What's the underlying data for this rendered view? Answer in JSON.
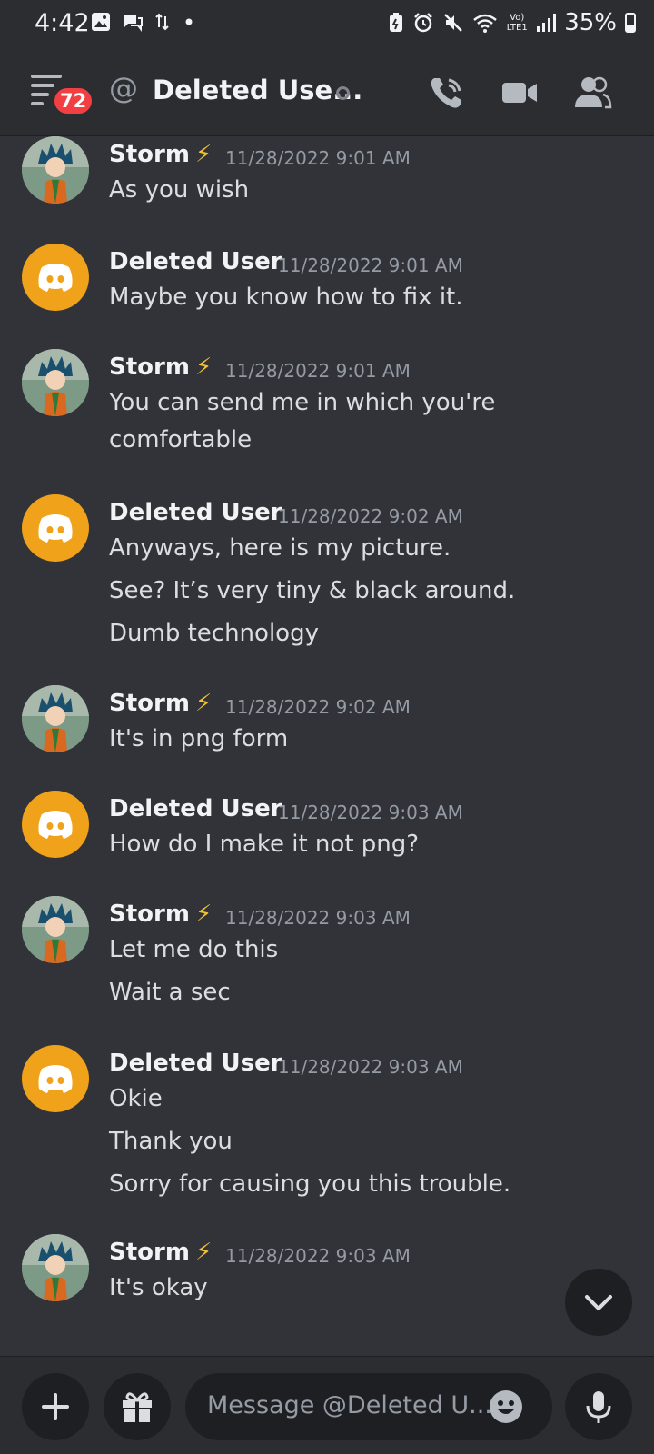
{
  "status_bar": {
    "time": "4:42",
    "battery": "35%",
    "network_label": "Vo) LTE1"
  },
  "header": {
    "notification_count": "72",
    "title": "Deleted Use..."
  },
  "messages": [
    {
      "author": "Storm",
      "bolt": "⚡",
      "timestamp": "11/28/2022 9:01 AM",
      "avatar": "storm",
      "lines": [
        "As you wish"
      ]
    },
    {
      "author": "Deleted User",
      "bolt": "",
      "timestamp": "11/28/2022 9:01 AM",
      "avatar": "discord",
      "lines": [
        "Maybe you know how to fix it."
      ]
    },
    {
      "author": "Storm",
      "bolt": "⚡",
      "timestamp": "11/28/2022 9:01 AM",
      "avatar": "storm",
      "lines": [
        "You can send me in which you're",
        "comfortable"
      ]
    },
    {
      "author": "Deleted User",
      "bolt": "",
      "timestamp": "11/28/2022 9:02 AM",
      "avatar": "discord",
      "lines": [
        "Anyways, here is my picture.",
        "See? It’s very tiny & black around.",
        "Dumb technology"
      ]
    },
    {
      "author": "Storm",
      "bolt": "⚡",
      "timestamp": "11/28/2022 9:02 AM",
      "avatar": "storm",
      "lines": [
        "It's in png form"
      ]
    },
    {
      "author": "Deleted User",
      "bolt": "",
      "timestamp": "11/28/2022 9:03 AM",
      "avatar": "discord",
      "lines": [
        "How do I make it not png?"
      ]
    },
    {
      "author": "Storm",
      "bolt": "⚡",
      "timestamp": "11/28/2022 9:03 AM",
      "avatar": "storm",
      "lines": [
        "Let me do this",
        "Wait a sec"
      ]
    },
    {
      "author": "Deleted User",
      "bolt": "",
      "timestamp": "11/28/2022 9:03 AM",
      "avatar": "discord",
      "lines": [
        "Okie",
        "Thank you",
        "Sorry for causing you this trouble."
      ]
    },
    {
      "author": "Storm",
      "bolt": "⚡",
      "timestamp": "11/28/2022 9:03 AM",
      "avatar": "storm",
      "lines": [
        "It's okay"
      ]
    }
  ],
  "composer": {
    "placeholder": "Message @Deleted U..."
  },
  "colors": {
    "background": "#313338",
    "header": "#2b2d31",
    "discord_avatar": "#f0a21a",
    "badge": "#f23f42"
  }
}
